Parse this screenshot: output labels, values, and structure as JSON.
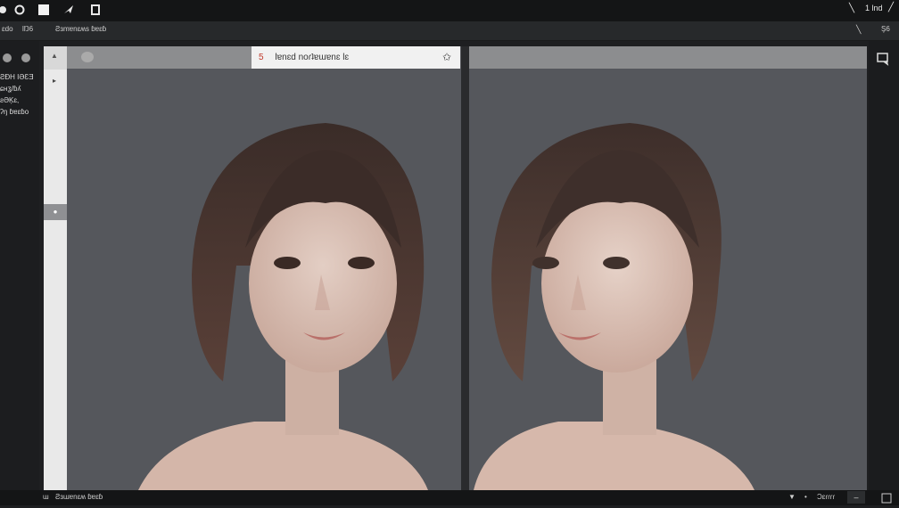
{
  "topbar": {
    "icons": [
      "circle-icon",
      "circle-outline-icon",
      "square-icon",
      "cursor-icon",
      "square-outline-icon"
    ],
    "right_text": "1 lnd",
    "chevron": "╲",
    "pen": "╱"
  },
  "menubar": {
    "items": [
      "ɛdo",
      "lŊ6",
      "Ƨɜmɐnɛʍs ɓɐɛɓ"
    ],
    "right_icon": "╲",
    "right_label": "Ş6"
  },
  "left_panel": {
    "lines": [
      "ƧƉH IƏƐƎ",
      "ɕʜʓ/ɓʎ",
      "ƨƏĶɛ,",
      "ʔŋ ɓɐɛɓo"
    ]
  },
  "left_pane": {
    "tab_prefix": "5",
    "tab_title": "lɐnɛd noɾʇɐɯɐnɛ lɛ",
    "ruler_arrow_up": "▲",
    "ruler_arrow": "▸",
    "ruler_marker": "●"
  },
  "right_panel": {
    "icon": "speech-bubble-icon"
  },
  "statusbar": {
    "left_glyph": "ɯ",
    "left_text": "Ƨɜɯɐnɛʍ ɓɐɛɓ",
    "right_items": [
      "▼",
      "•",
      "Ɔɛɾɾɾɾ"
    ],
    "right_box": "–"
  },
  "colors": {
    "background": "#55575c",
    "chrome": "#141516",
    "header": "#8c8d8f"
  }
}
